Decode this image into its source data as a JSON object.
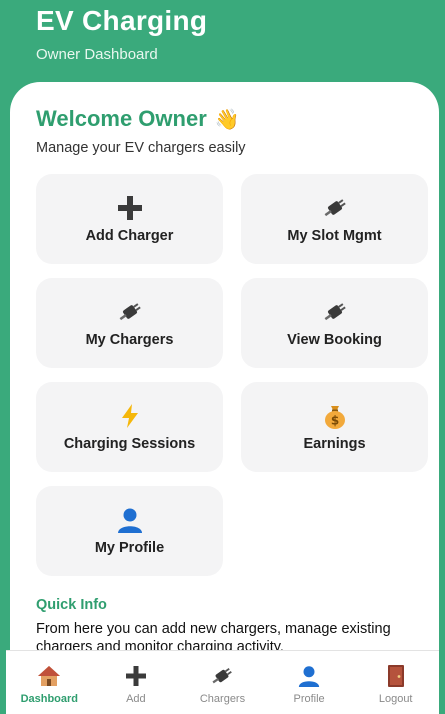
{
  "header": {
    "title": "EV Charging",
    "subtitle": "Owner Dashboard"
  },
  "welcome": {
    "title": "Welcome Owner",
    "emoji": "👋",
    "tagline": "Manage your EV chargers easily"
  },
  "cards": [
    {
      "label": "Add Charger",
      "icon": "plus-icon"
    },
    {
      "label": "My Slot Mgmt",
      "icon": "plug-icon"
    },
    {
      "label": "My Chargers",
      "icon": "plug-icon"
    },
    {
      "label": "View Booking",
      "icon": "plug-icon"
    },
    {
      "label": "Charging Sessions",
      "icon": "lightning-icon"
    },
    {
      "label": "Earnings",
      "icon": "money-bag-icon"
    },
    {
      "label": "My Profile",
      "icon": "user-icon"
    }
  ],
  "quick_info": {
    "title": "Quick Info",
    "text": "From here you can add new chargers, manage existing chargers and monitor charging activity."
  },
  "bottom_nav": [
    {
      "label": "Dashboard",
      "icon": "house-icon",
      "active": true
    },
    {
      "label": "Add",
      "icon": "plus-icon",
      "active": false
    },
    {
      "label": "Chargers",
      "icon": "plug-icon",
      "active": false
    },
    {
      "label": "Profile",
      "icon": "user-icon",
      "active": false
    },
    {
      "label": "Logout",
      "icon": "door-icon",
      "active": false
    }
  ],
  "colors": {
    "brand_green": "#3aaa7c",
    "heading_green": "#2f9e6f",
    "card_bg": "#f4f4f5"
  }
}
